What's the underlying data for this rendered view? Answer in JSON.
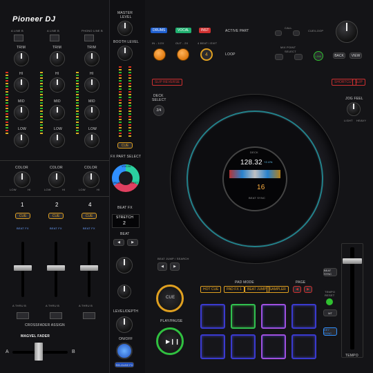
{
  "brand": {
    "name": "Pioneer DJ"
  },
  "mixer": {
    "master_level": "MASTER\nLEVEL",
    "booth_level": "BOOTH LEVEL",
    "inputs": [
      "A LINE B",
      "A LINE B",
      "PHONO LINE B"
    ],
    "rows": {
      "trim": "TRIM",
      "hi": "HI",
      "mid": "MID",
      "low": "LOW",
      "color": "COLOR",
      "color_low": "LOW",
      "color_hi": "HI"
    },
    "channels": [
      "1",
      "2",
      "4"
    ],
    "cue_label": "CUE",
    "beat_fx_label": "BEAT FX",
    "crossfader_assign": "CROSSFADER ASSIGN",
    "assign_abc": "A THRU B",
    "magvel": "MAGVEL FADER",
    "xf_a": "A",
    "xf_b": "B",
    "fx_part_select": "FX PART SELECT",
    "fx_parts": [
      "VOCAL",
      "INST",
      "DRUMS"
    ],
    "beat_fx": "BEAT FX",
    "stretch_display": "STRETCH",
    "stretch_value": "2",
    "beat": "BEAT",
    "level_depth": "LEVEL/DEPTH",
    "on_off": "ON/OFF",
    "release_fx": "RELEASE FX",
    "db_scale": [
      "+3",
      "0",
      "-3",
      "-6",
      "-9",
      "-12",
      "-15",
      "-18",
      "-24"
    ]
  },
  "deck": {
    "active_part_buttons": [
      "DRUMS",
      "VOCAL",
      "INST"
    ],
    "active_part_label": "ACTIVE PART",
    "loop_buttons": [
      "IN - 1/2X",
      "OUT - 2X",
      "4 BEAT / EXIT"
    ],
    "loop_value": "4",
    "loop_label": "LOOP",
    "call_label": "CALL",
    "cue_loop_label": "CUE/LOOP",
    "mix_point": "MIX POINT",
    "select": "SELECT",
    "link": "LINK",
    "back": "BACK",
    "view": "VIEW",
    "slip_reverse": "SLIP REVERSE",
    "shortcut": "SHORTCUT",
    "slip": "SLIP",
    "deck_select": "DECK\nSELECT",
    "deck_select_value": "2/4",
    "jog_feel": "JOG FEEL",
    "light": "LIGHT",
    "heavy": "HEAVY",
    "jog_display": {
      "deck": "DECK",
      "bpm": "128.32",
      "pitch": "+2.4%",
      "key": "16",
      "beat_sync": "BEAT SYNC"
    },
    "beat_jump_search": "BEAT JUMP / SEARCH",
    "cue": "CUE",
    "play_pause": "PLAY/PAUSE",
    "pad_mode": "PAD MODE",
    "pad_modes": [
      "HOT CUE",
      "PAD FX 1",
      "BEAT JUMP",
      "SAMPLER"
    ],
    "page": "PAGE",
    "tempo_reset": "TEMPO\nRESET",
    "master_tempo": "MASTER\nTEMPO",
    "key_sync": "KEY\nSYNC",
    "beat_sync_btn": "BEAT\nSYNC",
    "tempo": "TEMPO"
  }
}
